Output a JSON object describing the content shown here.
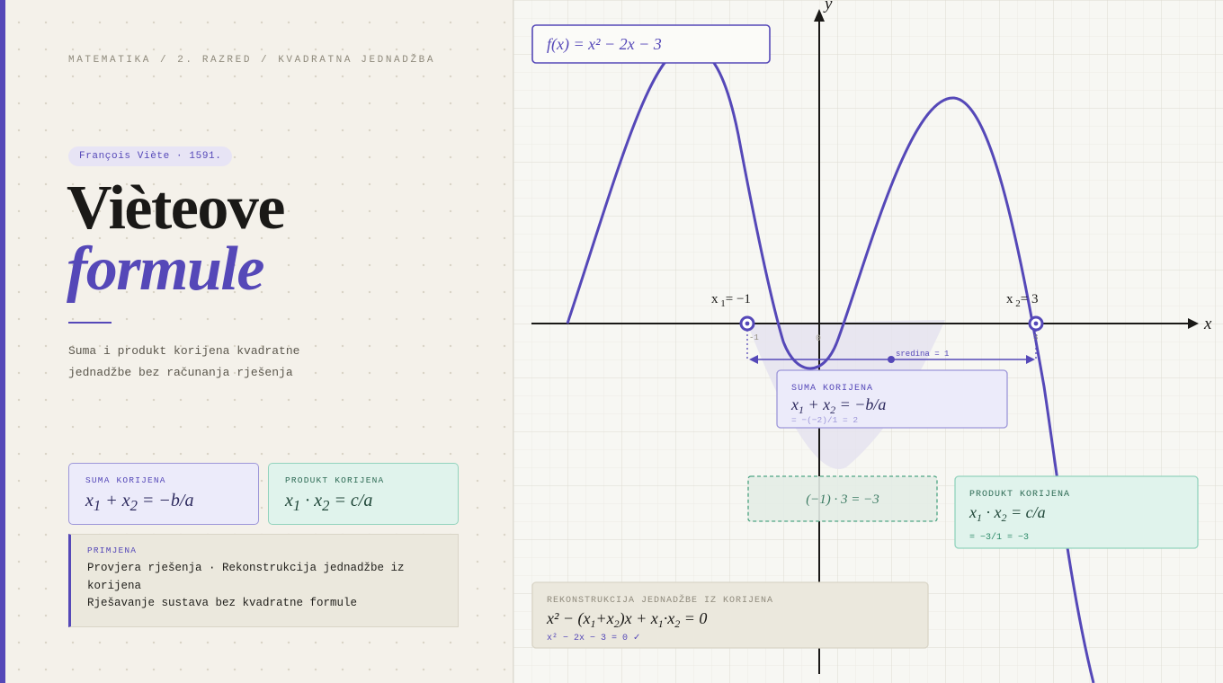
{
  "breadcrumb": [
    "MATEMATIKA",
    "2. RAZRED",
    "KVADRATNA JEDNADŽBA"
  ],
  "tag": "François Viète · 1591.",
  "title": {
    "line1": "Vièteove",
    "line2": "formule"
  },
  "subtitle": "Suma i produkt korijena kvadratne jednadžbe bez računanja rješenja",
  "cards": {
    "sum": {
      "label": "SUMA KORIJENA"
    },
    "product": {
      "label": "PRODUKT KORIJENA"
    }
  },
  "example": {
    "label": "PRIMJENA",
    "line1": "Provjera rješenja · Rekonstrukcija jednadžbe iz korijena",
    "line2": "Rješavanje sustava bez kvadratne formule"
  },
  "graph": {
    "function_label": "f(x) = x² − 2x − 3",
    "axis_x": "x",
    "axis_y": "y",
    "origin": "0",
    "root1": {
      "x": -1,
      "tick": "-1"
    },
    "root2": {
      "x": 3,
      "tick": "3"
    },
    "midpoint_label": "sredina = 1",
    "sum_box": {
      "label": "SUMA KORIJENA",
      "calc": "= −(−2)/1 = 2"
    },
    "product_box": {
      "label": "PRODUKT KORIJENA",
      "calc": "= −3/1 = −3"
    },
    "product_dashed": "(−1) · 3 = −3",
    "recon_box": {
      "label": "REKONSTRUKCIJA JEDNADŽBE IZ KORIJENA",
      "check": "x² − 2x − 3 = 0 ✓"
    },
    "curve_color": "#5548b8",
    "accent_green": "#2e8b6a"
  }
}
